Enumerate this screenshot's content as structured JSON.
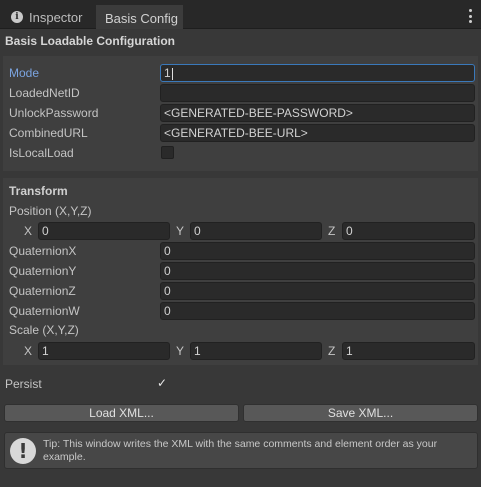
{
  "tabs": {
    "inspector_label": "Inspector",
    "basis_config_label": "Basis Config"
  },
  "header": {
    "title": "Basis Loadable Configuration"
  },
  "fields": {
    "mode": {
      "label": "Mode",
      "value": "1"
    },
    "loaded_net_id": {
      "label": "LoadedNetID",
      "value": ""
    },
    "unlock_password": {
      "label": "UnlockPassword",
      "value": "<GENERATED-BEE-PASSWORD>"
    },
    "combined_url": {
      "label": "CombinedURL",
      "value": "<GENERATED-BEE-URL>"
    },
    "is_local_load": {
      "label": "IsLocalLoad",
      "checked": false
    }
  },
  "transform": {
    "heading": "Transform",
    "position": {
      "label": "Position (X,Y,Z)",
      "x_label": "X",
      "x": "0",
      "y_label": "Y",
      "y": "0",
      "z_label": "Z",
      "z": "0"
    },
    "quaternion_x": {
      "label": "QuaternionX",
      "value": "0"
    },
    "quaternion_y": {
      "label": "QuaternionY",
      "value": "0"
    },
    "quaternion_z": {
      "label": "QuaternionZ",
      "value": "0"
    },
    "quaternion_w": {
      "label": "QuaternionW",
      "value": "0"
    },
    "scale": {
      "label": "Scale (X,Y,Z)",
      "x_label": "X",
      "x": "1",
      "y_label": "Y",
      "y": "1",
      "z_label": "Z",
      "z": "1"
    }
  },
  "persist": {
    "label": "Persist",
    "checked": true
  },
  "buttons": {
    "load_xml": "Load XML...",
    "save_xml": "Save XML..."
  },
  "tip": {
    "text": "Tip: This window writes the XML with the same comments and element order as your example."
  },
  "colors": {
    "background": "#383838",
    "field": "#2a2a2a",
    "focus_border": "#3a79bb",
    "focused_label": "#7ba4e0"
  }
}
